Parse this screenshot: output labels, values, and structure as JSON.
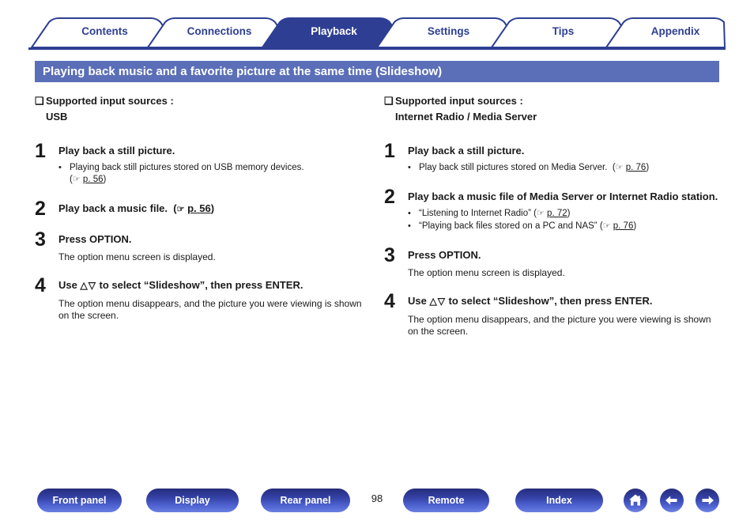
{
  "tabs": [
    {
      "label": "Contents",
      "active": false
    },
    {
      "label": "Connections",
      "active": false
    },
    {
      "label": "Playback",
      "active": true
    },
    {
      "label": "Settings",
      "active": false
    },
    {
      "label": "Tips",
      "active": false
    },
    {
      "label": "Appendix",
      "active": false
    }
  ],
  "title": "Playing back music and a favorite picture at the same time (Slideshow)",
  "colors": {
    "tab_active_fill": "#2e3f93",
    "tab_text": "#2e3f93",
    "banner": "#5b6fb8",
    "rule": "#2e3f93",
    "button_dark": "#252c7a",
    "button_light": "#6b7fe0"
  },
  "left": {
    "heading_label": "Supported input sources :",
    "heading_value": "USB",
    "bullet_glyph": "❏",
    "steps": [
      {
        "num": "1",
        "title": "Play back a still picture.",
        "bullets": [
          {
            "dot": "•",
            "text": "Playing back still pictures stored on USB memory devices.",
            "ref_open": "(",
            "ref_hand": "☞",
            "ref_page": "p. 56",
            "ref_close": ")",
            "ref_on_new_line": true
          }
        ],
        "note": ""
      },
      {
        "num": "2",
        "title": "Play back a music file.",
        "title_ref_open": "(",
        "title_ref_hand": "☞",
        "title_ref_page": "p. 56",
        "title_ref_close": ")",
        "bullets": [],
        "note": ""
      },
      {
        "num": "3",
        "title": "Press OPTION.",
        "bullets": [],
        "note": "The option menu screen is displayed."
      },
      {
        "num": "4",
        "title_pre": "Use ",
        "title_glyph": "△▽",
        "title_post": " to select “Slideshow”, then press ENTER.",
        "bullets": [],
        "note": "The option menu disappears, and the picture you were viewing is shown on the screen."
      }
    ]
  },
  "right": {
    "heading_label": "Supported input sources :",
    "heading_value": "Internet Radio / Media Server",
    "bullet_glyph": "❏",
    "steps": [
      {
        "num": "1",
        "title": "Play back a still picture.",
        "bullets": [
          {
            "dot": "•",
            "text": "Play back still pictures stored on Media Server.",
            "ref_open": "(",
            "ref_hand": "☞",
            "ref_page": "p. 76",
            "ref_close": ")",
            "ref_on_new_line": false
          }
        ],
        "note": ""
      },
      {
        "num": "2",
        "title": "Play back a music file of Media Server or Internet Radio station.",
        "bullets": [
          {
            "dot": "•",
            "text": "“Listening to Internet Radio”",
            "ref_open": "(",
            "ref_hand": "☞",
            "ref_page": "p. 72",
            "ref_close": ")",
            "ref_on_new_line": false
          },
          {
            "dot": "•",
            "text": "“Playing back files stored on a PC and NAS”",
            "ref_open": "(",
            "ref_hand": "☞",
            "ref_page": "p. 76",
            "ref_close": ")",
            "ref_on_new_line": false
          }
        ],
        "note": ""
      },
      {
        "num": "3",
        "title": "Press OPTION.",
        "bullets": [],
        "note": "The option menu screen is displayed."
      },
      {
        "num": "4",
        "title_pre": "Use ",
        "title_glyph": "△▽",
        "title_post": " to select “Slideshow”, then press ENTER.",
        "bullets": [],
        "note": "The option menu disappears, and the picture you were viewing is shown on the screen."
      }
    ]
  },
  "footer": {
    "buttons": [
      {
        "label": "Front panel"
      },
      {
        "label": "Display"
      },
      {
        "label": "Rear panel"
      },
      {
        "label": "Remote"
      },
      {
        "label": "Index"
      }
    ],
    "page_number": "98",
    "icons": [
      {
        "name": "home-icon"
      },
      {
        "name": "arrow-left-icon"
      },
      {
        "name": "arrow-right-icon"
      }
    ]
  }
}
